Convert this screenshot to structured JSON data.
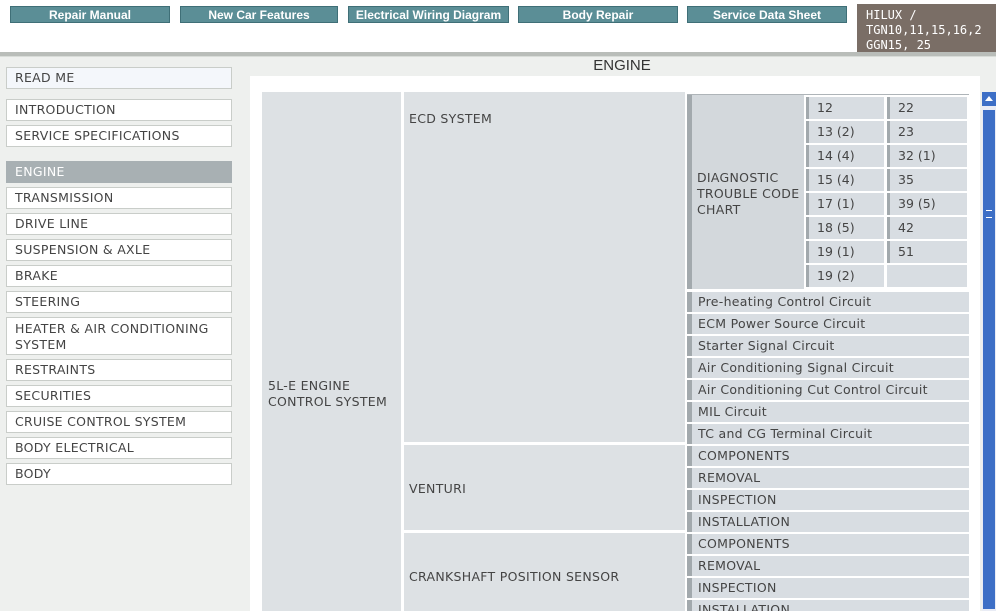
{
  "nav_tabs": [
    "Repair Manual",
    "New Car Features",
    "Electrical Wiring Diagram",
    "Body Repair",
    "Service Data Sheet"
  ],
  "model": {
    "line1": "HILUX /",
    "line2": "TGN10,11,15,16,2",
    "line3": "GGN15, 25"
  },
  "page_title": "ENGINE",
  "sidebar": {
    "items": [
      "READ ME",
      "INTRODUCTION",
      "SERVICE SPECIFICATIONS",
      "ENGINE",
      "TRANSMISSION",
      "DRIVE LINE",
      "SUSPENSION & AXLE",
      "BRAKE",
      "STEERING",
      "HEATER & AIR CONDITIONING SYSTEM",
      "RESTRAINTS",
      "SECURITIES",
      "CRUISE CONTROL SYSTEM",
      "BODY ELECTRICAL",
      "BODY"
    ],
    "active": "ENGINE"
  },
  "content": {
    "system": "5L-E ENGINE CONTROL SYSTEM",
    "ecd": {
      "label": "ECD SYSTEM",
      "dtc_label": "DIAGNOSTIC TROUBLE CODE CHART",
      "codes_left": [
        "12",
        "13 (2)",
        "14 (4)",
        "15 (4)",
        "17 (1)",
        "18 (5)",
        "19 (1)",
        "19 (2)"
      ],
      "codes_right": [
        "22",
        "23",
        "32 (1)",
        "35",
        "39 (5)",
        "42",
        "51"
      ],
      "circuits": [
        "Pre-heating Control Circuit",
        "ECM Power Source Circuit",
        "Starter Signal Circuit",
        "Air Conditioning Signal Circuit",
        "Air Conditioning Cut Control Circuit",
        "MIL Circuit",
        "TC and CG Terminal Circuit"
      ]
    },
    "venturi": {
      "label": "VENTURI",
      "items": [
        "COMPONENTS",
        "REMOVAL",
        "INSPECTION",
        "INSTALLATION"
      ]
    },
    "crankshaft": {
      "label": "CRANKSHAFT POSITION SENSOR",
      "items": [
        "COMPONENTS",
        "REMOVAL",
        "INSPECTION",
        "INSTALLATION"
      ]
    }
  },
  "colors": {
    "tab_bg": "#5b8e96",
    "model_bg": "#7a6e66",
    "active_item": "#a8b0b3",
    "scroll": "#3d6fc6"
  }
}
